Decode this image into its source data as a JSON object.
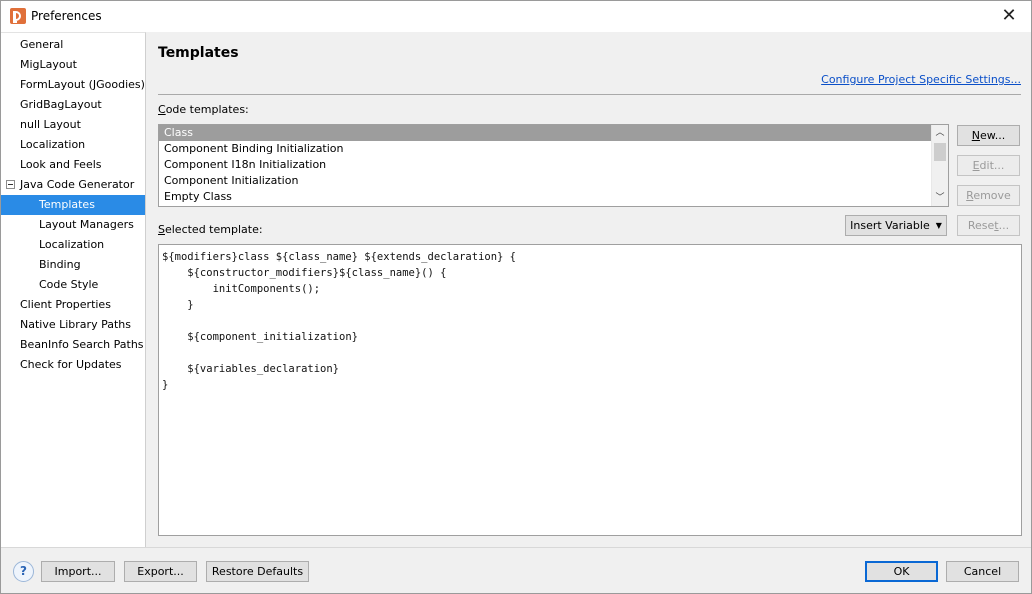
{
  "window": {
    "title": "Preferences"
  },
  "sidebar": {
    "items": [
      {
        "label": "General"
      },
      {
        "label": "MigLayout"
      },
      {
        "label": "FormLayout (JGoodies)"
      },
      {
        "label": "GridBagLayout"
      },
      {
        "label": "null Layout"
      },
      {
        "label": "Localization"
      },
      {
        "label": "Look and Feels"
      },
      {
        "label": "Java Code Generator",
        "expanded": true
      },
      {
        "label": "Templates",
        "selected": true
      },
      {
        "label": "Layout Managers"
      },
      {
        "label": "Localization"
      },
      {
        "label": "Binding"
      },
      {
        "label": "Code Style"
      },
      {
        "label": "Client Properties"
      },
      {
        "label": "Native Library Paths"
      },
      {
        "label": "BeanInfo Search Paths"
      },
      {
        "label": "Check for Updates"
      }
    ]
  },
  "main": {
    "title": "Templates",
    "configure_link": "Configure Project Specific Settings...",
    "code_templates_label": {
      "mnemonic": "C",
      "rest": "ode templates:"
    },
    "templates": [
      {
        "label": "Class",
        "selected": true
      },
      {
        "label": "Component Binding Initialization"
      },
      {
        "label": "Component I18n Initialization"
      },
      {
        "label": "Component Initialization"
      },
      {
        "label": "Empty Class"
      }
    ],
    "buttons": {
      "new": {
        "mnemonic": "N",
        "rest": "ew..."
      },
      "edit": {
        "mnemonic": "E",
        "rest": "dit..."
      },
      "remove": {
        "mnemonic": "R",
        "rest": "emove"
      },
      "insert_variable": "Insert Variable",
      "reset": {
        "pre": "Rese",
        "mnemonic": "t",
        "rest": "..."
      }
    },
    "selected_template_label": {
      "mnemonic": "S",
      "rest": "elected template:"
    },
    "template_code": "${modifiers}class ${class_name} ${extends_declaration} {\n    ${constructor_modifiers}${class_name}() {\n        initComponents();\n    }\n\n    ${component_initialization}\n\n    ${variables_declaration}\n}"
  },
  "footer": {
    "help": "?",
    "import": "Import...",
    "export": "Export...",
    "restore_defaults": "Restore Defaults",
    "ok": "OK",
    "cancel": "Cancel"
  },
  "colors": {
    "selection": "#2a8be6",
    "list_selection": "#9d9d9d",
    "link": "#0a4fc8",
    "primary_border": "#0a68d4"
  }
}
